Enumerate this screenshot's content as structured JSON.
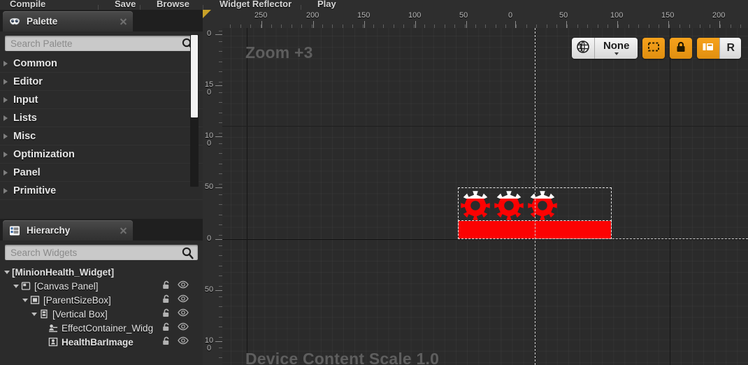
{
  "toolbar": {
    "items": [
      {
        "label": "Compile",
        "icon": "compile-icon"
      },
      {
        "label": "Save",
        "icon": "save-icon"
      },
      {
        "label": "Browse",
        "icon": "browse-icon"
      },
      {
        "label": "Widget Reflector",
        "icon": "widget-reflector-icon"
      },
      {
        "label": "Play",
        "icon": "play-icon"
      }
    ]
  },
  "palette": {
    "tab_label": "Palette",
    "tab_icon": "palette-mask-icon",
    "search": {
      "placeholder": "Search Palette",
      "value": "",
      "icon": "search-icon"
    },
    "categories": [
      {
        "label": "Common",
        "expanded": false
      },
      {
        "label": "Editor",
        "expanded": false
      },
      {
        "label": "Input",
        "expanded": false
      },
      {
        "label": "Lists",
        "expanded": false
      },
      {
        "label": "Misc",
        "expanded": false
      },
      {
        "label": "Optimization",
        "expanded": false
      },
      {
        "label": "Panel",
        "expanded": false
      },
      {
        "label": "Primitive",
        "expanded": false
      }
    ]
  },
  "hierarchy": {
    "tab_label": "Hierarchy",
    "tab_icon": "hierarchy-list-icon",
    "search": {
      "placeholder": "Search Widgets",
      "value": "",
      "icon": "search-icon"
    },
    "nodes": [
      {
        "label": "[MinionHealth_Widget]",
        "depth": 0,
        "bold": true,
        "expander": "expanded",
        "icon": null,
        "lock": false,
        "visible": false
      },
      {
        "label": "[Canvas Panel]",
        "depth": 1,
        "bold": false,
        "expander": "expanded",
        "icon": "canvas-panel-icon",
        "lock": true,
        "visible": true
      },
      {
        "label": "[ParentSizeBox]",
        "depth": 2,
        "bold": false,
        "expander": "expanded",
        "icon": "size-box-icon",
        "lock": true,
        "visible": true
      },
      {
        "label": "[Vertical Box]",
        "depth": 3,
        "bold": false,
        "expander": "expanded",
        "icon": "vertical-box-icon",
        "lock": true,
        "visible": true
      },
      {
        "label": "EffectContainer_Widg",
        "depth": 4,
        "bold": false,
        "expander": "none",
        "icon": "user-widget-icon",
        "lock": true,
        "visible": true
      },
      {
        "label": "HealthBarImage",
        "depth": 4,
        "bold": true,
        "expander": "none",
        "icon": "image-widget-icon",
        "lock": true,
        "visible": true
      }
    ]
  },
  "designer": {
    "zoom_label": "Zoom +3",
    "scale_label": "Device Content Scale 1.0",
    "ruler_h_labels": [
      "250",
      "200",
      "150",
      "100",
      "50",
      "0",
      "50",
      "100",
      "150",
      "200"
    ],
    "ruler_v_labels": [
      "0",
      "150",
      "100",
      "50",
      "0",
      "50",
      "100"
    ],
    "toolbar": {
      "globe_icon": "globe-icon",
      "resolution_value": "None",
      "dropdown_icon": "chevron-down-icon",
      "dashed_outline_icon": "show-outlines-icon",
      "lock_icon": "lock-icon",
      "dock_icon": "dock-window-icon",
      "r_label": "R"
    },
    "selection": {
      "accent_color": "#fc0202",
      "outline_color": "#e9e9e9",
      "gear_count": 3
    }
  }
}
